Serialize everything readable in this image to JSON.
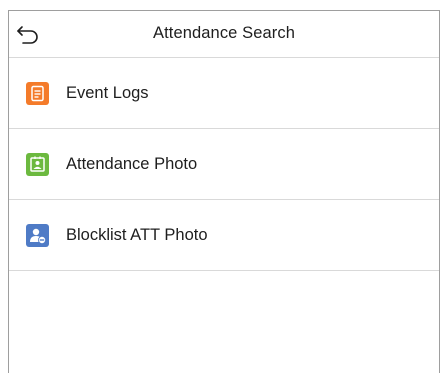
{
  "header": {
    "title": "Attendance Search",
    "back_icon": "back-arrow-icon"
  },
  "menu": {
    "items": [
      {
        "label": "Event Logs",
        "icon": "document-icon",
        "color": "#f47b2a"
      },
      {
        "label": "Attendance Photo",
        "icon": "photo-frame-icon",
        "color": "#6cb93f"
      },
      {
        "label": "Blocklist ATT Photo",
        "icon": "user-block-icon",
        "color": "#4f7bc6"
      }
    ]
  }
}
